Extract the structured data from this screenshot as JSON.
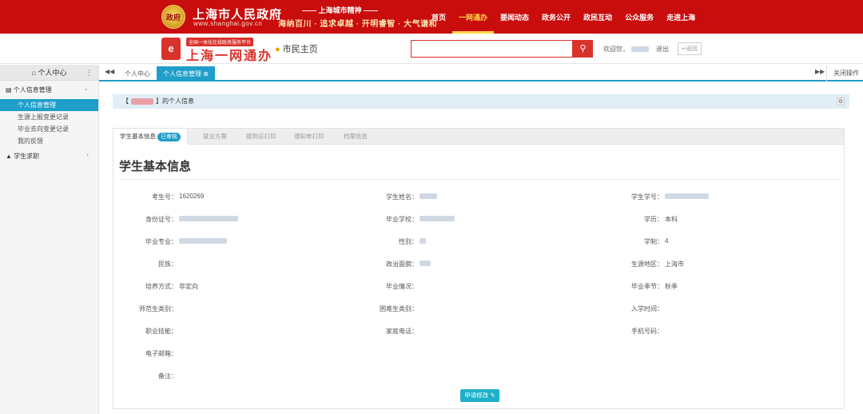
{
  "header": {
    "emblem_text": "政府",
    "gov_title": "上海市人民政府",
    "gov_url": "www.shanghai.gov.cn",
    "spirit_top": "—— 上海城市精神 ——",
    "spirit_bottom": "海纳百川 · 追求卓越 · 开明睿智 · 大气谦和",
    "nav": [
      "首页",
      "一网通办",
      "要闻动态",
      "政务公开",
      "政民互动",
      "公众服务",
      "走进上海"
    ],
    "nav_active": "一网通办"
  },
  "subheader": {
    "badge": "全国一体化在线政务服务平台",
    "title": "上海一网通办",
    "home_link": "市民主页",
    "search_placeholder": "",
    "welcome_prefix": "欢迎您，",
    "logout": "退出",
    "back": "↩返回"
  },
  "sidebar": {
    "title": "个人中心",
    "groups": [
      {
        "label": "个人信息管理",
        "items": [
          "个人信息管理",
          "生源上报变更记录",
          "毕业去向变更记录",
          "我的反馈"
        ],
        "active": "个人信息管理"
      },
      {
        "label": "学生求职",
        "items": []
      }
    ]
  },
  "tabs": {
    "items": [
      "个人中心",
      "个人信息管理"
    ],
    "active": "个人信息管理",
    "close_ops": "关闭操作"
  },
  "panel": {
    "title_suffix": "的个人信息"
  },
  "card": {
    "tabs": [
      "学生基本信息",
      "就业方案",
      "报到证打印",
      "通知单打印",
      "档案信息"
    ],
    "badge": "已审核",
    "title": "学生基本信息",
    "fields": [
      {
        "label": "考生号：",
        "value": "1620269"
      },
      {
        "label": "学生姓名：",
        "value": ""
      },
      {
        "label": "学生学号：",
        "value": ""
      },
      {
        "label": "身份证号：",
        "value": ""
      },
      {
        "label": "毕业学校：",
        "value": ""
      },
      {
        "label": "学历：",
        "value": "本科"
      },
      {
        "label": "毕业专业：",
        "value": ""
      },
      {
        "label": "性别：",
        "value": ""
      },
      {
        "label": "学制：",
        "value": "4"
      },
      {
        "label": "民族：",
        "value": ""
      },
      {
        "label": "政治面貌：",
        "value": ""
      },
      {
        "label": "生源地区：",
        "value": "上海市"
      },
      {
        "label": "培养方式：",
        "value": "非定向"
      },
      {
        "label": "毕业情况：",
        "value": ""
      },
      {
        "label": "毕业季节：",
        "value": "秋季"
      },
      {
        "label": "师范生类别：",
        "value": ""
      },
      {
        "label": "困难生类别：",
        "value": ""
      },
      {
        "label": "入学时间：",
        "value": ""
      },
      {
        "label": "职业技能：",
        "value": ""
      },
      {
        "label": "家庭电话：",
        "value": ""
      },
      {
        "label": "手机号码：",
        "value": ""
      },
      {
        "label": "电子邮箱：",
        "value": ""
      },
      {
        "label": "备注：",
        "value": ""
      }
    ],
    "apply_button": "申请修改"
  }
}
